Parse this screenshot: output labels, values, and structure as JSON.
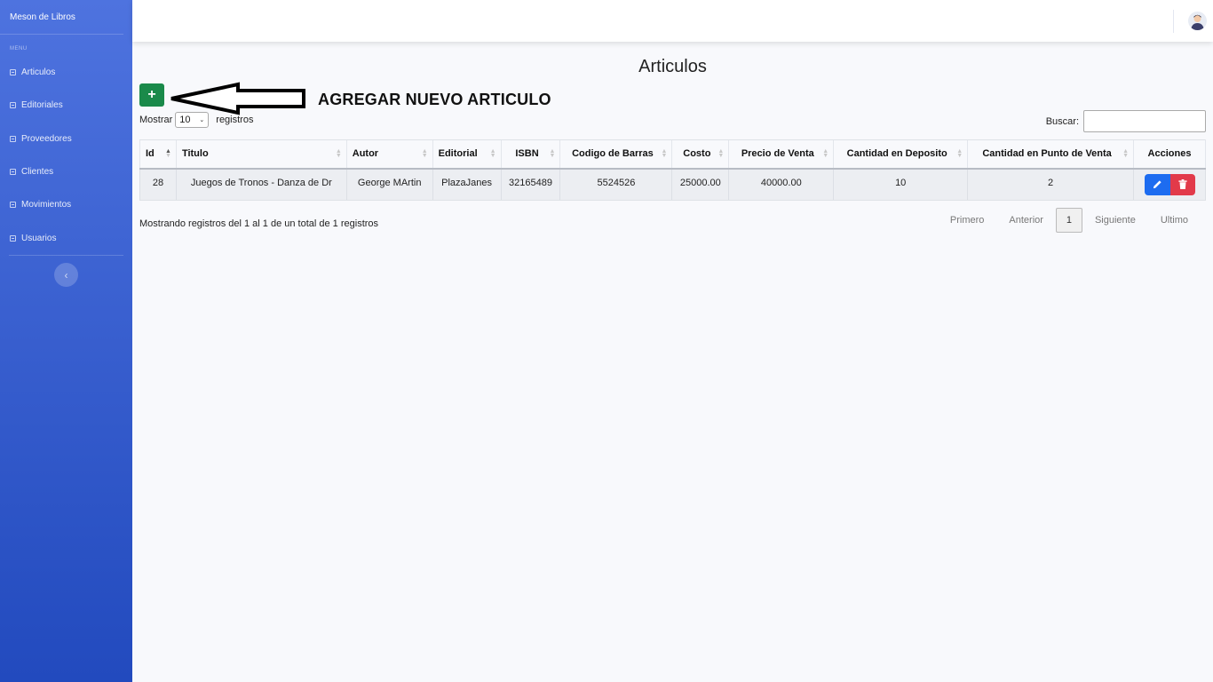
{
  "sidebar": {
    "brand": "Meson de Libros",
    "menu_heading": "MENU",
    "items": [
      {
        "label": "Articulos"
      },
      {
        "label": "Editoriales"
      },
      {
        "label": "Proveedores"
      },
      {
        "label": "Clientes"
      },
      {
        "label": "Movimientos"
      },
      {
        "label": "Usuarios"
      }
    ],
    "toggle_icon": "chevron-left-icon"
  },
  "topbar": {
    "avatar_icon": "user-avatar-icon"
  },
  "main": {
    "title": "Articulos",
    "add_button": "+",
    "add_annotation": "AGREGAR NUEVO ARTICULO",
    "length_prefix": "Mostrar",
    "length_value": "10",
    "length_suffix": "registros",
    "search_label": "Buscar:",
    "search_value": "",
    "columns": [
      "Id",
      "Titulo",
      "Autor",
      "Editorial",
      "ISBN",
      "Codigo de Barras",
      "Costo",
      "Precio de Venta",
      "Cantidad en Deposito",
      "Cantidad en Punto de Venta",
      "Acciones"
    ],
    "rows": [
      [
        "28",
        "Juegos de Tronos - Danza de Dr",
        "George MArtin",
        "PlazaJanes",
        "32165489",
        "5524526",
        "25000.00",
        "40000.00",
        "10",
        "2"
      ]
    ],
    "info": "Mostrando registros del 1 al 1 de un total de 1 registros",
    "pagination": {
      "first": "Primero",
      "prev": "Anterior",
      "current": "1",
      "next": "Siguiente",
      "last": "Ultimo"
    }
  },
  "colors": {
    "sidebar_top": "#4e73df",
    "sidebar_bottom": "#224abe",
    "add": "#1a8a4a",
    "edit": "#1d6cf0",
    "delete": "#e23a4a"
  }
}
